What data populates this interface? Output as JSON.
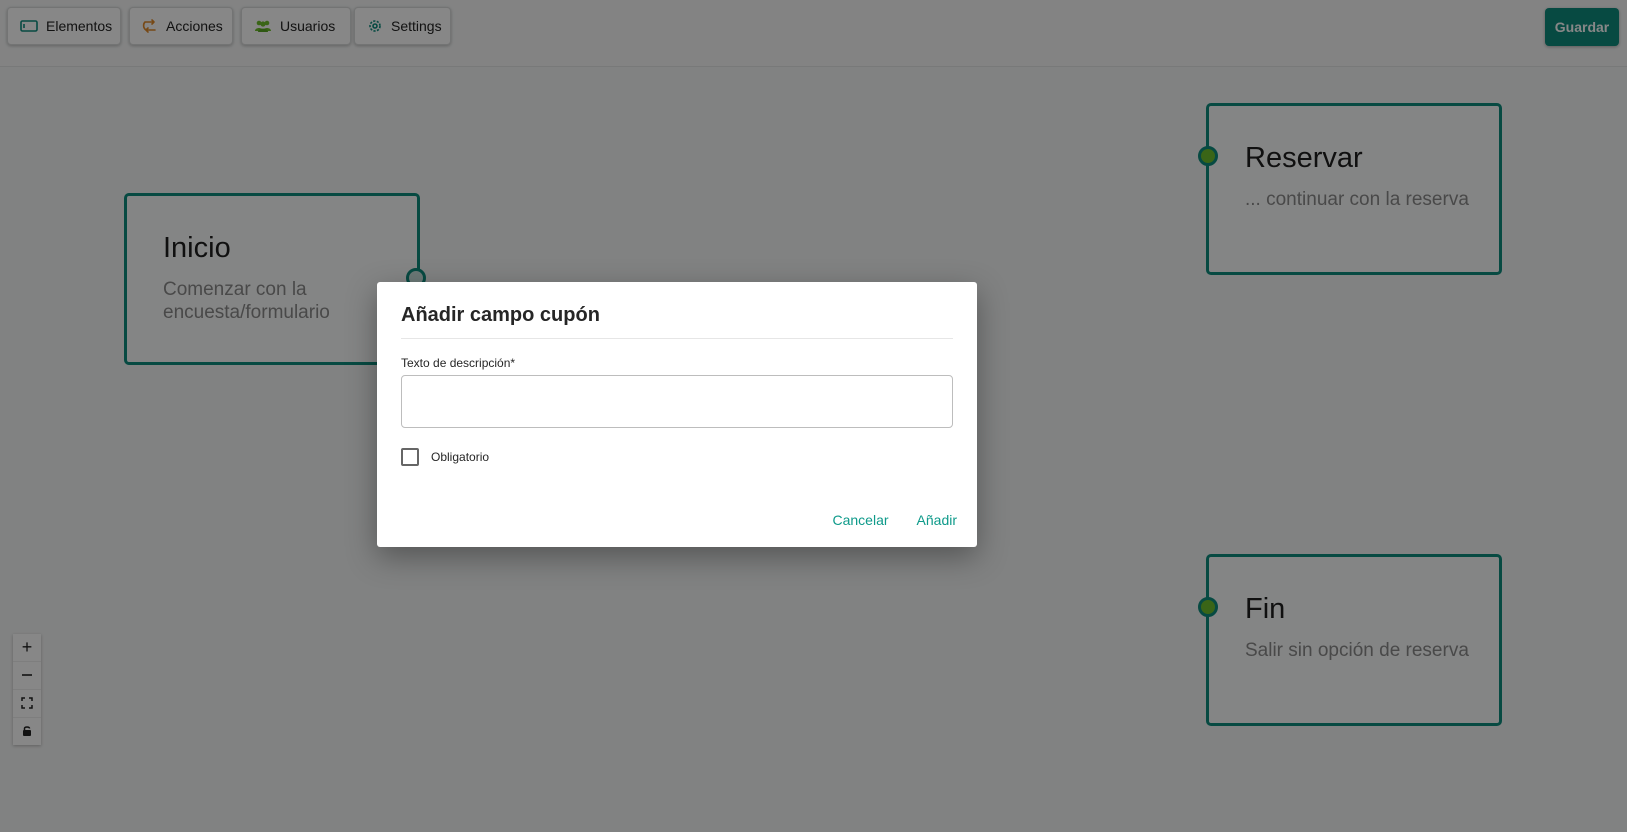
{
  "toolbar": {
    "buttons": [
      {
        "label": "Elementos",
        "icon": "panel-icon"
      },
      {
        "label": "Acciones",
        "icon": "swap-arrows-icon"
      },
      {
        "label": "Usuarios",
        "icon": "users-icon"
      },
      {
        "label": "Settings",
        "icon": "gear-icon"
      }
    ],
    "save_label": "Guardar"
  },
  "nodes": {
    "inicio": {
      "title": "Inicio",
      "description": "Comenzar con la encuesta/formulario"
    },
    "reservar": {
      "title": "Reservar",
      "description": "... continuar con la reserva"
    },
    "fin": {
      "title": "Fin",
      "description": "Salir sin opción de reserva"
    }
  },
  "zoom_controls": {
    "zoom_in": "+",
    "zoom_out": "—",
    "fit_view": "fit-view-icon",
    "lock": "lock-icon"
  },
  "dialog": {
    "title": "Añadir campo cupón",
    "field_label": "Texto de descripción*",
    "field_value": "",
    "checkbox_label": "Obligatorio",
    "checkbox_checked": false,
    "cancel_label": "Cancelar",
    "add_label": "Añadir"
  },
  "colors": {
    "accent": "#0e8c7e",
    "handle_green": "#6fbf2c",
    "link": "#0e9a8a",
    "acciones_icon": "#e08a2a",
    "usuarios_icon": "#6fbf2c"
  }
}
